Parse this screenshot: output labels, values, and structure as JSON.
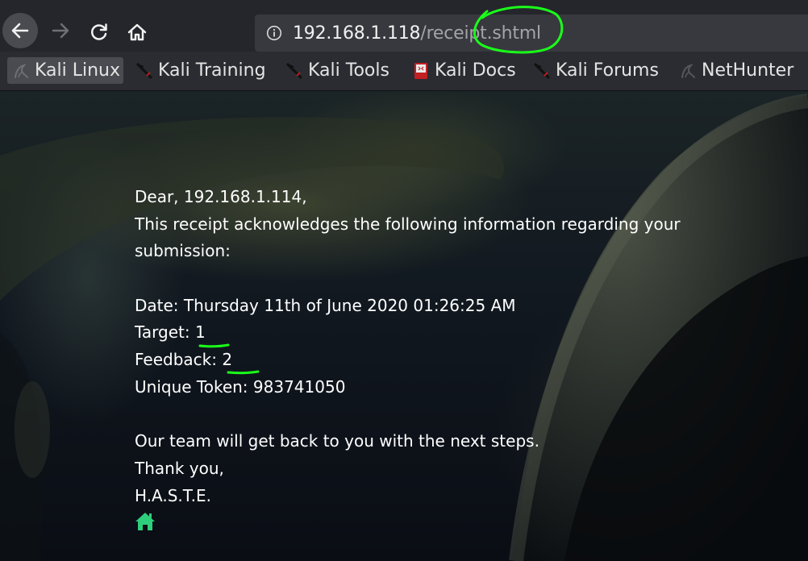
{
  "toolbar": {
    "back_icon": "arrow-left-icon",
    "forward_icon": "arrow-right-icon",
    "reload_icon": "reload-icon",
    "home_icon": "home-icon",
    "url_host": "192.168.1.118",
    "url_path": "/receipt.shtml",
    "info_icon": "info-icon"
  },
  "bookmarks": [
    {
      "label": "Kali Linux",
      "icon": "kali-dragon-icon"
    },
    {
      "label": "Kali Training",
      "icon": "kali-sword-icon"
    },
    {
      "label": "Kali Tools",
      "icon": "kali-sword-icon"
    },
    {
      "label": "Kali Docs",
      "icon": "kali-docs-icon"
    },
    {
      "label": "Kali Forums",
      "icon": "kali-sword-icon"
    },
    {
      "label": "NetHunter",
      "icon": "kali-dragon-icon"
    }
  ],
  "receipt": {
    "greeting": "Dear, 192.168.1.114,",
    "intro_line1": "This receipt acknowledges the following information regarding your",
    "intro_line2": "submission:",
    "date": "Date: Thursday 11th of June 2020 01:26:25 AM",
    "target_label": "Target: ",
    "target_value": "1",
    "feedback_label": "Feedback: ",
    "feedback_value": "2",
    "token": "Unique Token: 983741050",
    "closing": "Our team will get back to you with the next steps.",
    "thanks": "Thank you,",
    "signature": "H.A.S.T.E.",
    "home_link_icon": "home-icon"
  },
  "colors": {
    "toolbar_bg": "#25262b",
    "urlbar_bg": "#38393e",
    "bookmarks_bg": "#2b2c31",
    "annotation_green": "#1aff1a",
    "home_link_color": "#2ecf7a"
  }
}
